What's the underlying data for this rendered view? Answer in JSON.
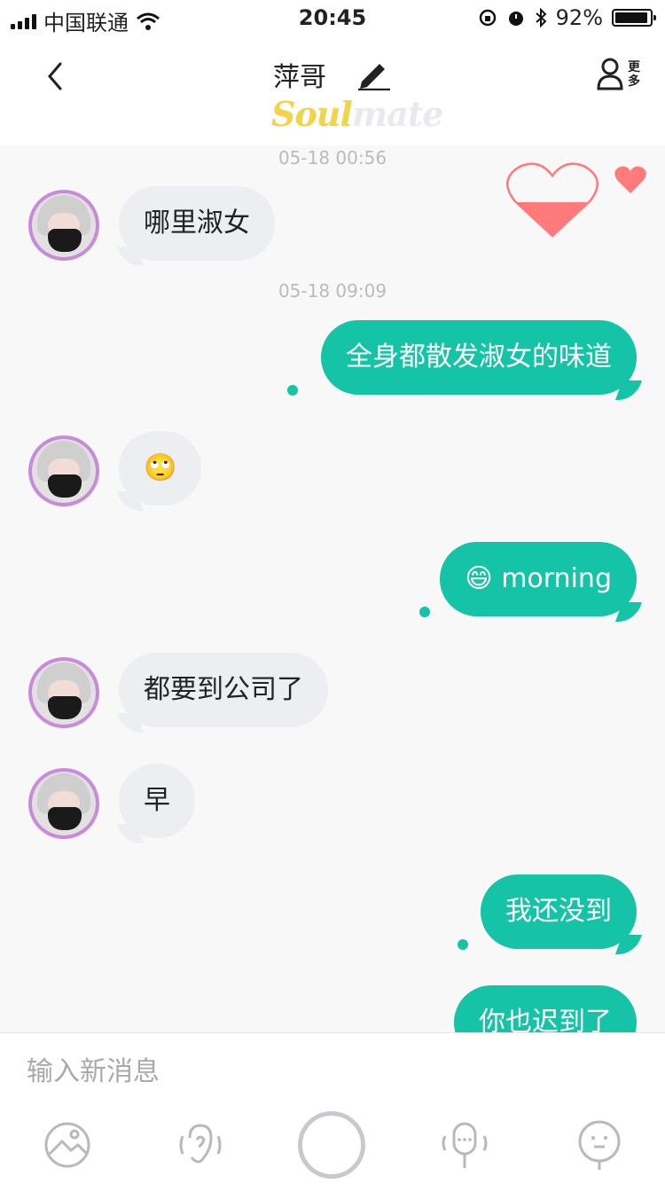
{
  "status": {
    "carrier": "中国联通",
    "time": "20:45",
    "battery": "92%"
  },
  "header": {
    "title": "萍哥",
    "brand_soul": "Soul",
    "brand_mate": "mate",
    "more": "更多",
    "more_top": "更",
    "more_bottom": "多"
  },
  "chat": {
    "timestamps": [
      "05-18 00:56",
      "05-18 09:09"
    ],
    "messages": [
      {
        "side": "in",
        "text": "哪里淑女"
      },
      {
        "side": "out",
        "text": "全身都散发淑女的味道"
      },
      {
        "side": "in",
        "emoji": "🙄",
        "text": ""
      },
      {
        "side": "out",
        "emoji": "😄",
        "text": "morning"
      },
      {
        "side": "in",
        "text": "都要到公司了"
      },
      {
        "side": "in",
        "text": "早"
      },
      {
        "side": "out",
        "text": "我还没到"
      },
      {
        "side": "out",
        "text": "你也迟到了"
      }
    ]
  },
  "input": {
    "placeholder": "输入新消息"
  },
  "toolbar": {
    "icons": [
      "image-icon",
      "ear-icon",
      "record-button",
      "microphone-icon",
      "emoji-icon"
    ]
  },
  "colors": {
    "accent": "#15c3a6",
    "incoming_bubble": "#eceef1",
    "avatar_ring": "#c78bd9",
    "heart": "#ff7a7a"
  }
}
